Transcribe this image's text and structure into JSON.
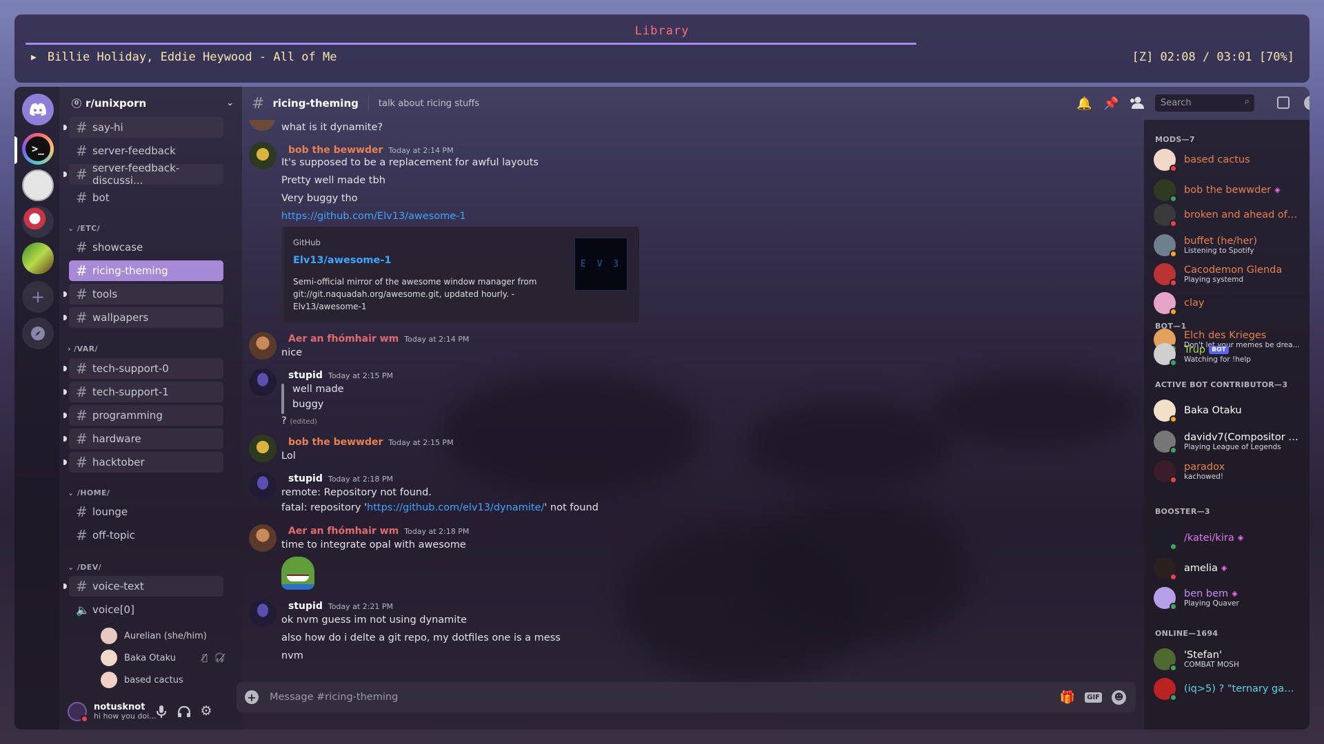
{
  "player": {
    "title": "Library",
    "play_icon": "play-icon",
    "track": "Billie Holiday, Eddie Heywood - All of Me",
    "time": "[Z] 02:08 / 03:01 [70%]",
    "progress": 0.7
  },
  "server": {
    "name": "r/unixporn",
    "badge": "0",
    "top_channels": [
      "say-hi",
      "server-feedback",
      "server-feedback-discussi...",
      "bot"
    ],
    "categories": [
      {
        "name": "/ETC/",
        "channels": [
          "showcase",
          "ricing-theming",
          "tools",
          "wallpapers"
        ]
      },
      {
        "name": "/VAR/",
        "channels": [
          "tech-support-0",
          "tech-support-1",
          "programming",
          "hardware",
          "hacktober"
        ]
      },
      {
        "name": "/HOME/",
        "channels": [
          "lounge",
          "off-topic"
        ]
      },
      {
        "name": "/DEV/",
        "channels": [
          "voice-text"
        ]
      }
    ],
    "voice_channel": "voice[0]",
    "voice_users": [
      "Aurelian (she/him)",
      "Baka Otaku",
      "based cactus"
    ]
  },
  "user": {
    "name": "notusknot",
    "status": "hi how you doi..."
  },
  "channel": {
    "name": "ricing-theming",
    "topic": "talk about ricing stuffs"
  },
  "search": {
    "placeholder": "Search"
  },
  "composer": {
    "placeholder": "Message #ricing-theming",
    "gif": "GIF"
  },
  "messages": {
    "m0": {
      "text": "what is it dynamite?"
    },
    "m1": {
      "author": "bob the bewwder",
      "ts": "Today at 2:14 PM",
      "color": "#e8824c",
      "lines": [
        "It's supposed to be a replacement for awful layouts",
        "Pretty well made tbh",
        "Very buggy tho",
        "https://github.com/Elv13/awesome-1"
      ],
      "embed": {
        "provider": "GitHub",
        "title": "Elv13/awesome-1",
        "desc1": "Semi-official mirror of the awesome window manager from",
        "desc2": "git://git.naquadah.org/awesome.git, updated hourly. -",
        "desc3": "Elv13/awesome-1",
        "thumb": "E V 3"
      }
    },
    "m2": {
      "author": "Aer an fhómhair wm",
      "ts": "Today at 2:14 PM",
      "color": "#e06c6c",
      "lines": [
        "nice"
      ]
    },
    "m3": {
      "author": "stupid",
      "ts": "Today at 2:15 PM",
      "color": "#ffffff",
      "quote1": "well made",
      "quote2": "buggy",
      "text": "?",
      "edited": "(edited)"
    },
    "m4": {
      "author": "bob the bewwder",
      "ts": "Today at 2:15 PM",
      "color": "#e8824c",
      "lines": [
        "Lol"
      ]
    },
    "m5": {
      "author": "stupid",
      "ts": "Today at 2:18 PM",
      "color": "#ffffff",
      "line1": "remote: Repository not found.",
      "line2a": "fatal: repository '",
      "line2link": "https://github.com/elv13/dynamite/",
      "line2b": "' not found"
    },
    "m6": {
      "author": "Aer an fhómhair wm",
      "ts": "Today at 2:18 PM",
      "color": "#e06c6c",
      "lines": [
        "time to integrate opal with awesome"
      ]
    },
    "m7": {
      "author": "stupid",
      "ts": "Today at 2:21 PM",
      "color": "#ffffff",
      "lines": [
        "ok nvm guess im not using dynamite",
        "also how do i delte a git repo, my dotfiles one is a mess",
        "nvm"
      ]
    }
  },
  "members": {
    "mods": {
      "header": "MODS—7",
      "list": [
        {
          "name": "based cactus",
          "status": "",
          "color": "#e8824c",
          "s": "#ed4245"
        },
        {
          "name": "bob the bewwder",
          "status": "",
          "color": "#e8824c",
          "s": "#3ba55c"
        },
        {
          "name": "broken and ahead of s...",
          "status": "",
          "color": "#e8824c",
          "s": "#ed4245"
        },
        {
          "name": "buffet (he/her)",
          "status": "Listening to Spotify",
          "color": "#e8824c",
          "s": "#faa61a"
        },
        {
          "name": "Cacodemon Glenda",
          "status": "Playing systemd",
          "color": "#e8824c",
          "s": "#ed4245"
        },
        {
          "name": "clay",
          "status": "",
          "color": "#e8824c",
          "s": "#faa61a"
        },
        {
          "name": "Elch des Krieges",
          "status": "Don't let your memes be drea...",
          "color": "#e8824c",
          "s": "#3ba55c"
        }
      ]
    },
    "bot": {
      "header": "BOT—1",
      "list": [
        {
          "name": "Trup",
          "tag": "BOT",
          "status": "Watching for !help",
          "color": "#a3d94e",
          "s": "#3ba55c"
        }
      ]
    },
    "contrib": {
      "header": "ACTIVE BOT CONTRIBUTOR—3",
      "list": [
        {
          "name": "Baka Otaku",
          "status": "",
          "color": "#ffffff",
          "s": "#faa61a"
        },
        {
          "name": "davidv7(Compositor n...",
          "status": "Playing League of Legends",
          "color": "#ffffff",
          "s": "#3ba55c"
        },
        {
          "name": "paradox",
          "status": "kachowed!",
          "color": "#e8824c",
          "s": "#ed4245"
        }
      ]
    },
    "booster": {
      "header": "BOOSTER—3",
      "list": [
        {
          "name": "/katei/kira",
          "status": "",
          "color": "#e279f0",
          "s": "#3ba55c"
        },
        {
          "name": "amelia",
          "status": "",
          "color": "#ffffff",
          "s": "#ed4245"
        },
        {
          "name": "ben bem",
          "status": "Playing Quaver",
          "color": "#c78ef0",
          "s": "#3ba55c"
        }
      ]
    },
    "online": {
      "header": "ONLINE—1694",
      "list": [
        {
          "name": "'Stefan'",
          "status": "COMBAT MOSH",
          "color": "#ffffff",
          "s": "#3ba55c"
        },
        {
          "name": "(iq>5) ? \"ternary gang...",
          "status": "",
          "color": "#5fd4e8",
          "s": "#3ba55c"
        }
      ]
    }
  }
}
